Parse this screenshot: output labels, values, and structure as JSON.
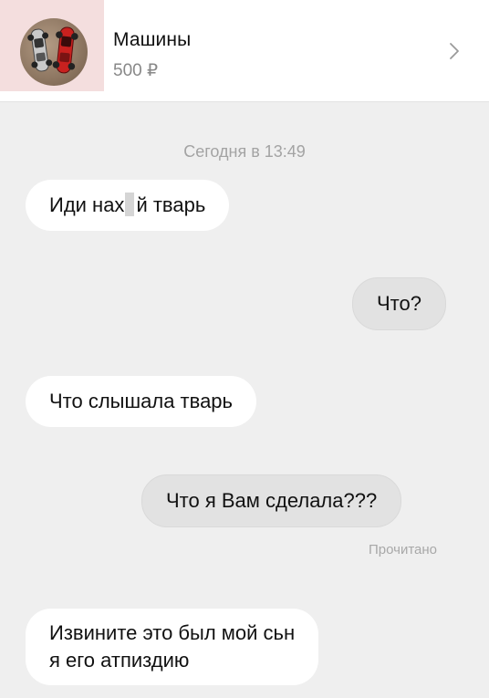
{
  "listing": {
    "title": "Машины",
    "price": "500 ₽",
    "thumbnail_icon": "toy-cars-photo",
    "chevron_icon": "chevron-right-icon"
  },
  "chat": {
    "date_label": "Сегодня в 13:49",
    "messages": [
      {
        "direction": "incoming",
        "text_before": "Иди нах",
        "text_after": "й тварь",
        "censored": true
      },
      {
        "direction": "outgoing",
        "text": "Что?"
      },
      {
        "direction": "incoming",
        "text": "Что слышала тварь"
      },
      {
        "direction": "outgoing",
        "text": "Что я Вам сделала???"
      },
      {
        "direction": "incoming",
        "line1": "Извините это был мой сьн",
        "line2": "я его атпиздию"
      }
    ],
    "read_status": "Прочитано"
  },
  "colors": {
    "background": "#efefef",
    "incoming_bubble": "#ffffff",
    "outgoing_bubble": "#e2e2e2",
    "muted_text": "#a3a3a3"
  }
}
